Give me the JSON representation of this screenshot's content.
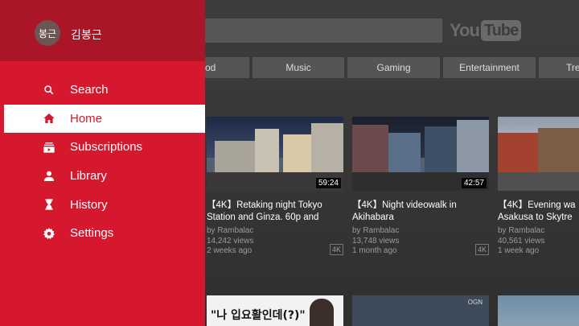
{
  "user": {
    "avatar_text": "봉근",
    "name": "김봉근"
  },
  "menu": [
    {
      "label": "Search",
      "icon": "search-icon",
      "active": false
    },
    {
      "label": "Home",
      "icon": "home-icon",
      "active": true
    },
    {
      "label": "Subscriptions",
      "icon": "subscriptions-icon",
      "active": false
    },
    {
      "label": "Library",
      "icon": "library-icon",
      "active": false
    },
    {
      "label": "History",
      "icon": "history-icon",
      "active": false
    },
    {
      "label": "Settings",
      "icon": "settings-icon",
      "active": false
    }
  ],
  "logo": {
    "you": "You",
    "tube": "Tube"
  },
  "chips": [
    "od",
    "Music",
    "Gaming",
    "Entertainment",
    "Tre"
  ],
  "videos": [
    {
      "title": "【4K】Retaking night Tokyo Station and Ginza. 60p and",
      "channel": "by Rambalac",
      "views": "14,242 views",
      "age": "2 weeks ago",
      "duration": "59:24",
      "badge": "4K"
    },
    {
      "title": "【4K】Night videowalk in Akihabara",
      "channel": "by Rambalac",
      "views": "13,748 views",
      "age": "1 month ago",
      "duration": "42:57",
      "badge": "4K"
    },
    {
      "title": "【4K】Evening wa Asakusa to Skytre",
      "channel": "by Rambalac",
      "views": "40,561 views",
      "age": "1 week ago",
      "duration": "",
      "badge": ""
    }
  ],
  "row2": {
    "thumb1_text": "\"나 입요활인데(?)\"",
    "thumb2_text": "OGN"
  },
  "colors": {
    "drawer": "#d6182f",
    "drawer_header": "#aa1627",
    "active_bg": "#ffffff"
  }
}
